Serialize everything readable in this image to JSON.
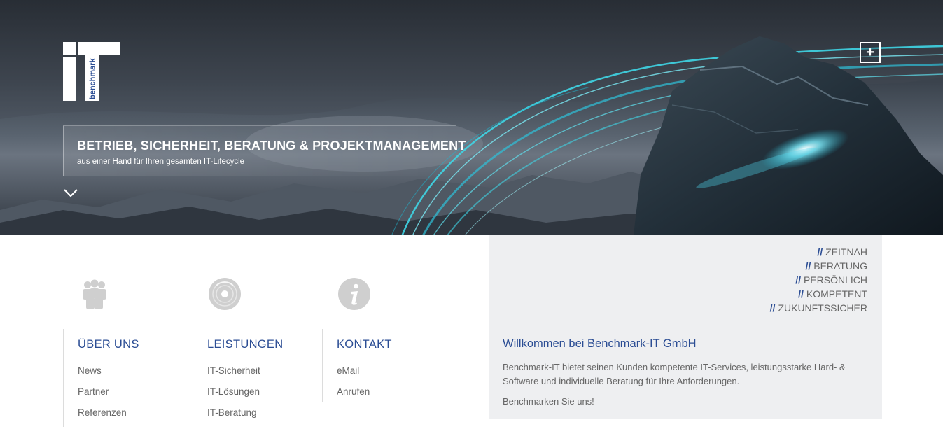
{
  "brand": {
    "logo_text": "benchmark"
  },
  "hero": {
    "title": "BETRIEB, SICHERHEIT, BERATUNG & PROJEKTMANAGEMENT",
    "subtitle": "aus einer Hand für Ihren gesamten IT-Lifecycle",
    "expand_label": "+"
  },
  "columns": [
    {
      "icon": "people-icon",
      "title": "ÜBER UNS",
      "links": [
        "News",
        "Partner",
        "Referenzen"
      ]
    },
    {
      "icon": "disc-icon",
      "title": "LEISTUNGEN",
      "links": [
        "IT-Sicherheit",
        "IT-Lösungen",
        "IT-Beratung"
      ]
    },
    {
      "icon": "info-icon",
      "title": "KONTAKT",
      "links": [
        "eMail",
        "Anrufen"
      ]
    }
  ],
  "panel": {
    "prefix": "//",
    "keywords": [
      "ZEITNAH",
      "BERATUNG",
      "PERSÖNLICH",
      "KOMPETENT",
      "ZUKUNFTSSICHER"
    ],
    "welcome_title": "Willkommen bei Benchmark-IT GmbH",
    "intro": "Benchmark-IT bietet seinen Kunden kompetente IT-Services, leistungsstarke Hard- & Software und individuelle Beratung für Ihre Anforderungen.",
    "cta": "Benchmarken Sie uns!"
  },
  "colors": {
    "accent": "#2b4d94",
    "text": "#666666",
    "panel_bg": "#eeeff1",
    "icon_gray": "#cfcfcf",
    "glow": "#3fd6e6"
  }
}
